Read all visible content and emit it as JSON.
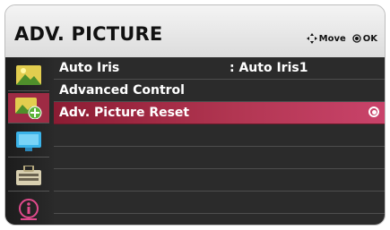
{
  "menu": {
    "title": "ADV. PICTURE"
  },
  "hints": {
    "move_label": "Move",
    "ok_label": "OK"
  },
  "side_icons": [
    {
      "name": "picture-icon",
      "active": false
    },
    {
      "name": "picture-settings-icon",
      "active": true
    },
    {
      "name": "screen-icon",
      "active": false
    },
    {
      "name": "setup-icon",
      "active": false
    },
    {
      "name": "info-icon",
      "active": false
    }
  ],
  "rows": [
    {
      "label": "Auto Iris",
      "value": ": Auto Iris1"
    },
    {
      "label": "Advanced Control",
      "value": ""
    },
    {
      "label": "Adv. Picture Reset",
      "value": ""
    }
  ],
  "selected_row": "Adv. Picture Reset",
  "colors": {
    "highlight": "#b23652",
    "active_icon_bg": "#9e2b44",
    "panel_bg": "#2b2b2b"
  }
}
